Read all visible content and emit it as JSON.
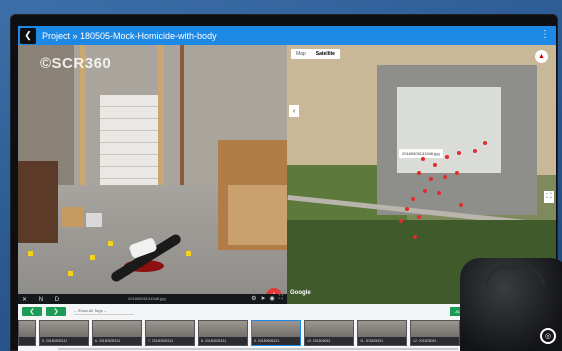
{
  "header": {
    "title": "Project » 180505-Mock-Homicide-with-body",
    "back_glyph": "❮",
    "menu_glyph": "⋮"
  },
  "photo": {
    "watermark": "©SCR360",
    "file_label": "20180505131546.jpg",
    "toolbar_glyphs": "✕ N D",
    "fab_glyph": "+",
    "icons": [
      "settings-icon",
      "forward-icon",
      "eye-icon",
      "fullscreen-icon"
    ]
  },
  "map": {
    "tabs": [
      "Map",
      "Satellite"
    ],
    "active_tab": "Satellite",
    "selected_label": "20180505131546.jpg",
    "attribution": "Google",
    "left_control_glyph": "‹",
    "right_control_glyph": "⛶"
  },
  "strip": {
    "prev_glyph": "❮",
    "next_glyph": "❯",
    "tag_filter": "-- Show All Tags --",
    "add_button": "ADD TAG",
    "thumbnails": [
      {
        "label": "5. 20180505131"
      },
      {
        "label": "6. 20180505131"
      },
      {
        "label": "7. 20180505131"
      },
      {
        "label": "8. 20180505131"
      },
      {
        "label": "9. 20180505131"
      },
      {
        "label": "10. 201805051"
      },
      {
        "label": "11. 201805051"
      },
      {
        "label": "12. 201805051"
      },
      {
        "label": "13. 201805051"
      }
    ]
  },
  "colors": {
    "accent": "#1e88e5",
    "action_green": "#1c9b57",
    "fab_red": "#e53935",
    "pin_red": "#e32b2b"
  }
}
